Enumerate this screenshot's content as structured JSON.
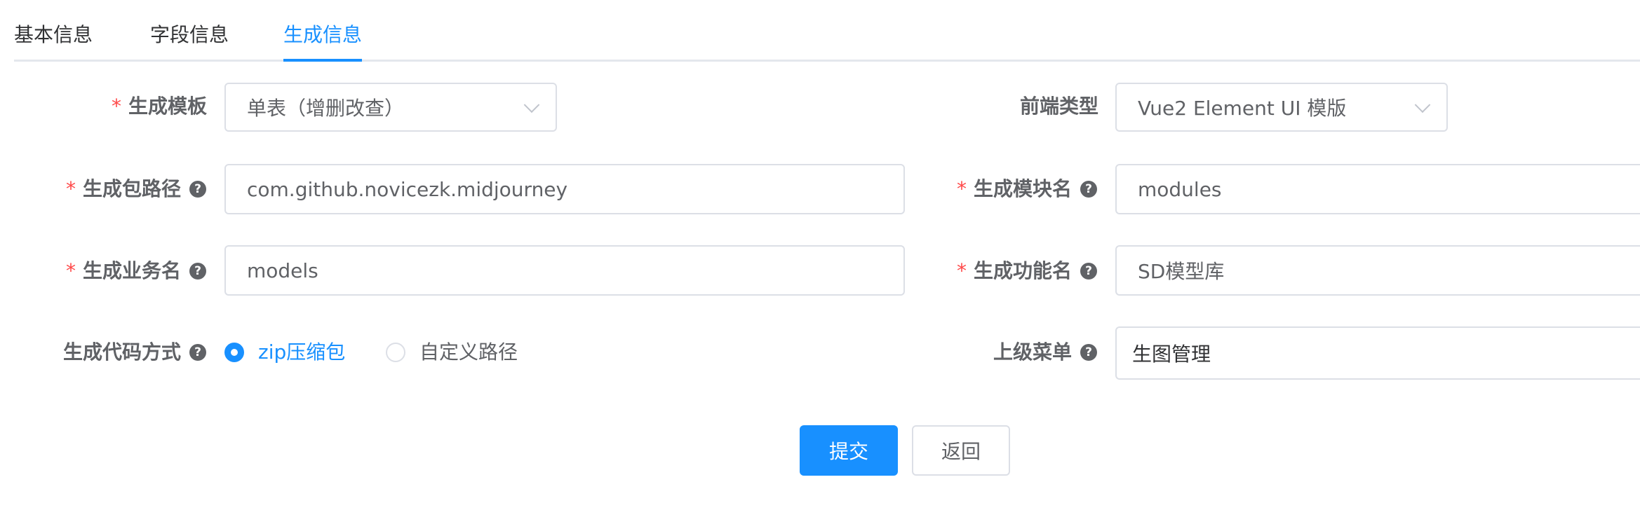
{
  "tabs": [
    {
      "label": "基本信息",
      "active": false
    },
    {
      "label": "字段信息",
      "active": false
    },
    {
      "label": "生成信息",
      "active": true
    }
  ],
  "form": {
    "tpl_category": {
      "label": "生成模板",
      "required": true,
      "value": "单表（增删改查）"
    },
    "frontend_type": {
      "label": "前端类型",
      "required": false,
      "value": "Vue2 Element UI 模版"
    },
    "package_name": {
      "label": "生成包路径",
      "required": true,
      "value": "com.github.novicezk.midjourney"
    },
    "module_name": {
      "label": "生成模块名",
      "required": true,
      "value": "modules"
    },
    "business_name": {
      "label": "生成业务名",
      "required": true,
      "value": "models"
    },
    "function_name": {
      "label": "生成功能名",
      "required": true,
      "value": "SD模型库"
    },
    "gen_type": {
      "label": "生成代码方式",
      "options": [
        "zip压缩包",
        "自定义路径"
      ],
      "selected": "zip压缩包"
    },
    "parent_menu": {
      "label": "上级菜单",
      "value": "生图管理"
    },
    "required_mark": "*",
    "help_glyph": "?"
  },
  "buttons": {
    "submit": "提交",
    "back": "返回"
  },
  "colors": {
    "primary": "#1890ff",
    "required": "#ff4949",
    "border": "#dcdfe6",
    "text": "#606266"
  }
}
